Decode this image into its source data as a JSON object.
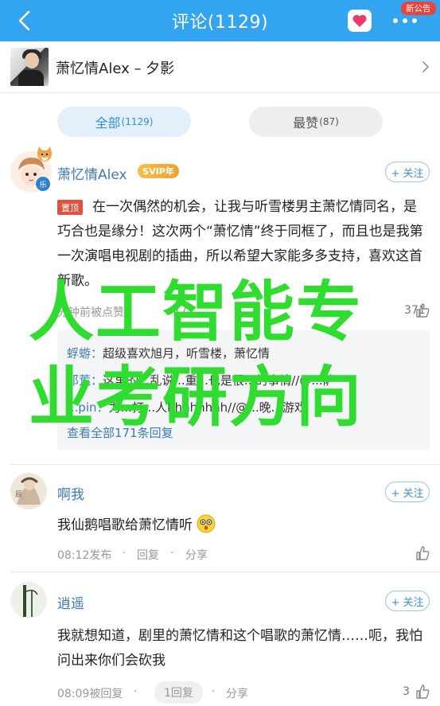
{
  "header": {
    "title": "评论(1129)",
    "notice_badge": "新公告",
    "accent": "#33a4f0"
  },
  "song": {
    "title": "萧忆情Alex – 夕影"
  },
  "tabs": [
    {
      "label": "全部",
      "count": "(1129)"
    },
    {
      "label": "最赞",
      "count": "(87)"
    }
  ],
  "comments": [
    {
      "name": "萧忆情Alex",
      "badge": "SVIP年",
      "follow": "+ 关注",
      "pinned": "置顶",
      "text": "在一次偶然的机会，让我与听雪楼男主萧忆情同名，是巧合也是缘分！这次两个“萧忆情”终于同框了，而且也是我第一次演唱电视剧的插曲，所以希望大家能多多支持，喜欢这首新歌。",
      "meta": "分钟前被点赞",
      "meta2": "17...",
      "likes": "371",
      "replies": [
        {
          "name": "蜉蝣：",
          "text": "超级喜欢旭月，听雪楼，萧忆情"
        },
        {
          "name": "邓荒：",
          "text": "这里的...乱说...重...也是很...的事情//@...萨"
        },
        {
          "name": "...pin：",
          "text": "为...打...人hhhhhhhh//@...晚...游戏"
        }
      ],
      "view_all": "查看全部171条回复"
    },
    {
      "name": "啊我",
      "follow": "+ 关注",
      "text": "我仙鹅唱歌给萧忆情听",
      "meta_time": "08:12发布",
      "reply": "回复",
      "share": "分享"
    },
    {
      "name": "逍遥",
      "follow": "+ 关注",
      "text": "我就想知道，剧里的萧忆情和这个唱歌的萧忆情……呃，我怕问出来你们会砍我",
      "meta_time": "08:09被回复",
      "reply": "1回复",
      "share": "分享",
      "likes": "3"
    }
  ],
  "watermark": {
    "line1": "人工智能专",
    "line2": "业考研方向",
    "color": "#2fdc2f"
  }
}
